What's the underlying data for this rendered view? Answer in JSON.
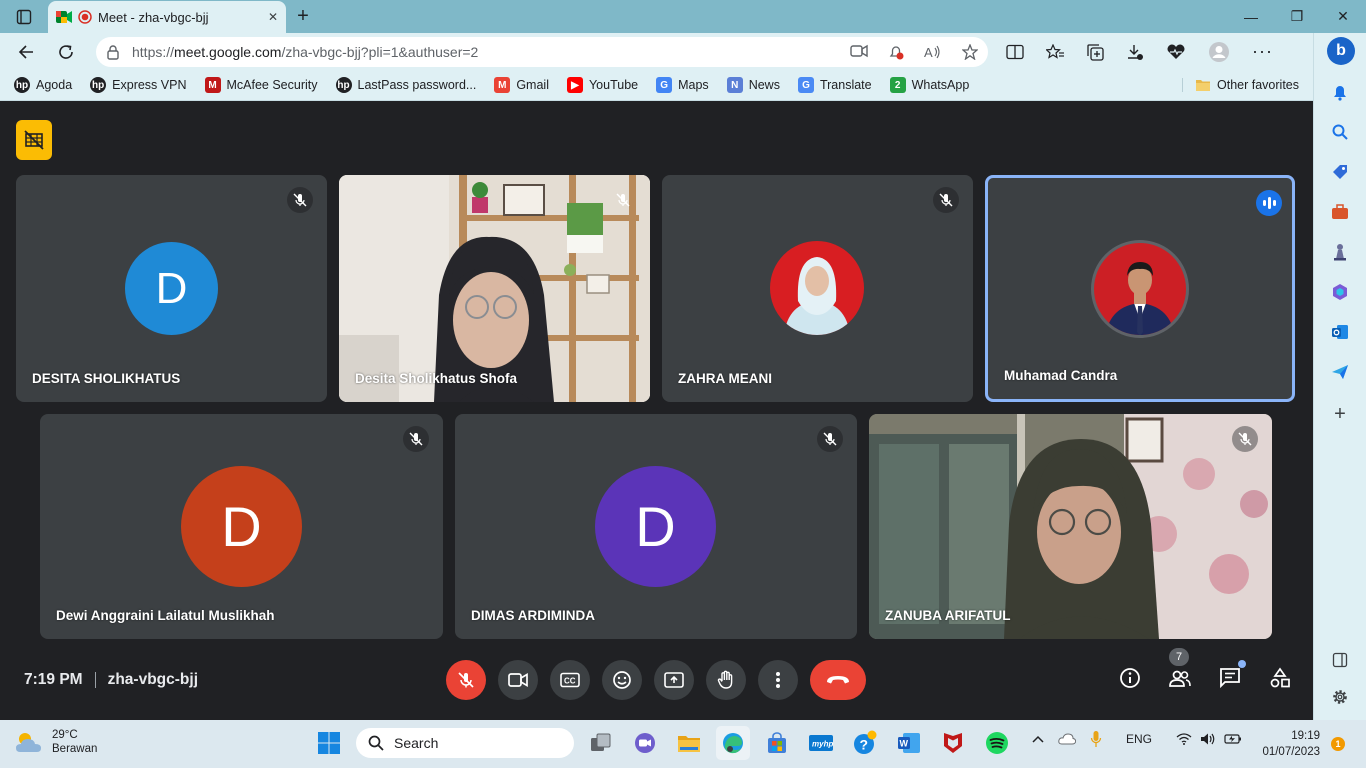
{
  "browser": {
    "tab": {
      "title": "Meet - zha-vbgc-bjj",
      "close": "✕"
    },
    "new_tab": "+",
    "window_controls": {
      "minimize": "—",
      "restore": "❐",
      "close": "✕"
    },
    "url": {
      "prefix": "https://",
      "host": "meet.google.com",
      "rest": "/zha-vbgc-bjj?pli=1&authuser=2"
    },
    "bookmarks": [
      {
        "label": "Agoda",
        "icon": "hp-icon",
        "color": "#202124",
        "glyph": "hp"
      },
      {
        "label": "Express VPN",
        "icon": "hp-icon",
        "color": "#202124",
        "glyph": "hp"
      },
      {
        "label": "McAfee Security",
        "icon": "mcafee-icon",
        "color": "#c01818",
        "glyph": "M"
      },
      {
        "label": "LastPass password...",
        "icon": "hp-icon",
        "color": "#202124",
        "glyph": "hp"
      },
      {
        "label": "Gmail",
        "icon": "gmail-icon",
        "color": "#ea4335",
        "glyph": "M"
      },
      {
        "label": "YouTube",
        "icon": "youtube-icon",
        "color": "#ff0000",
        "glyph": "▶"
      },
      {
        "label": "Maps",
        "icon": "google-icon",
        "color": "#4285f4",
        "glyph": "G"
      },
      {
        "label": "News",
        "icon": "news-icon",
        "color": "#5b7fd6",
        "glyph": "N"
      },
      {
        "label": "Translate",
        "icon": "translate-icon",
        "color": "#4a8af4",
        "glyph": "G"
      },
      {
        "label": "WhatsApp",
        "icon": "whatsapp-icon",
        "color": "#25a244",
        "glyph": "2"
      }
    ],
    "other_favorites": "Other favorites"
  },
  "meet": {
    "participants_row1": [
      {
        "name": "DESITA SHOLIKHATUS",
        "type": "avatar",
        "initial": "D",
        "color": "#1f8ad6",
        "muted": true
      },
      {
        "name": "Desita Sholikhatus Shofa",
        "type": "video",
        "muted": true
      },
      {
        "name": "ZAHRA MEANI",
        "type": "photo",
        "muted": true
      },
      {
        "name": "Muhamad Candra",
        "type": "photo",
        "speaking": true
      }
    ],
    "participants_row2": [
      {
        "name": "Dewi Anggraini Lailatul Muslikhah",
        "type": "avatar",
        "initial": "D",
        "color": "#c5401b",
        "muted": true
      },
      {
        "name": "DIMAS ARDIMINDA",
        "type": "avatar",
        "initial": "D",
        "color": "#5b34b8",
        "muted": true
      },
      {
        "name": "ZANUBA ARIFATUL",
        "type": "video",
        "muted": true
      }
    ],
    "time": "7:19 PM",
    "meeting_code": "zha-vbgc-bjj",
    "participant_count": "7"
  },
  "taskbar": {
    "weather": {
      "temp": "29°C",
      "condition": "Berawan"
    },
    "search_placeholder": "Search",
    "language": "ENG",
    "time": "19:19",
    "date": "01/07/2023",
    "notifications": "1"
  }
}
